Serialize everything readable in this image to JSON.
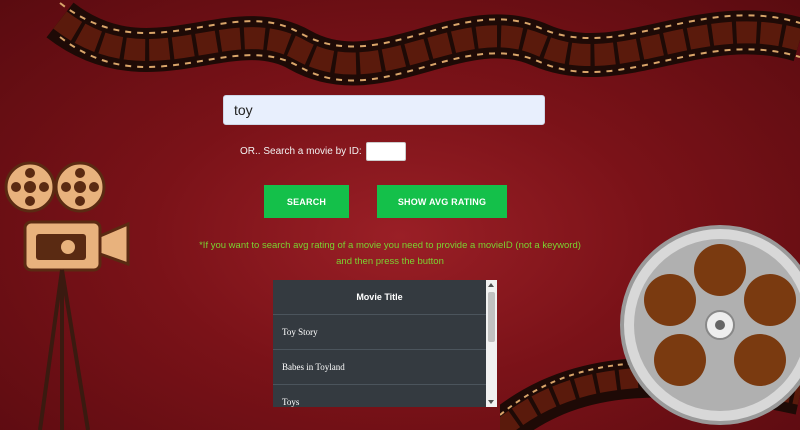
{
  "search": {
    "value": "toy",
    "placeholder": ""
  },
  "id_search": {
    "label": "OR.. Search a movie by ID:",
    "value": ""
  },
  "buttons": {
    "search_label": "SEARCH",
    "avg_label": "SHOW AVG RATING"
  },
  "notice": {
    "line1": "*If you want to search avg rating of a movie you need to provide a movieID (not a keyword)",
    "line2": "and then press the button"
  },
  "table": {
    "header": "Movie Title",
    "rows": [
      "Toy Story",
      "Babes in Toyland",
      "Toys"
    ]
  },
  "colors": {
    "background": "#7a1218",
    "button": "#14c04a",
    "notice_text": "#7bd332",
    "table_bg": "#343a40"
  },
  "decor": {
    "top_image": "film-strip-icon",
    "left_image": "movie-camera-icon",
    "right_image": "film-reel-icon",
    "bottom_right_image": "film-strip-icon"
  }
}
